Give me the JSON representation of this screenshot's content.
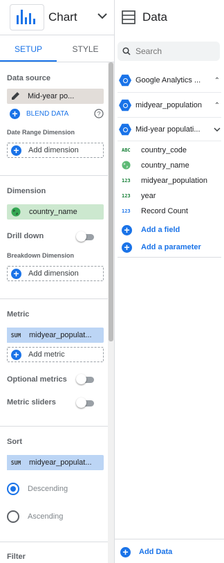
{
  "header": {
    "chart_label": "Chart",
    "data_label": "Data"
  },
  "tabs": [
    {
      "label": "SETUP",
      "active": true
    },
    {
      "label": "STYLE",
      "active": false
    }
  ],
  "setup": {
    "data_source": {
      "title": "Data source",
      "value": "Mid-year po...",
      "blend_label": "BLEND DATA"
    },
    "date_range": {
      "title": "Date Range Dimension",
      "add_label": "Add dimension"
    },
    "dimension": {
      "title": "Dimension",
      "value": "country_name"
    },
    "drill_down": {
      "label": "Drill down"
    },
    "breakdown": {
      "title": "Breakdown Dimension",
      "add_label": "Add dimension"
    },
    "metric": {
      "title": "Metric",
      "agg": "SUM",
      "value": "midyear_populat...",
      "add_label": "Add metric"
    },
    "optional_metrics": {
      "label": "Optional metrics"
    },
    "metric_sliders": {
      "label": "Metric sliders"
    },
    "sort": {
      "title": "Sort",
      "agg": "SUM",
      "value": "midyear_populat...",
      "descending": "Descending",
      "ascending": "Ascending"
    },
    "filter": {
      "title": "Filter"
    }
  },
  "data_panel": {
    "search_placeholder": "Search",
    "sources": [
      {
        "name": "Google Analytics ...",
        "expanded": false
      },
      {
        "name": "midyear_population",
        "expanded": false
      },
      {
        "name": "Mid-year populati...",
        "expanded": true
      }
    ],
    "fields": [
      {
        "type": "ABC",
        "name": "country_code"
      },
      {
        "type": "globe",
        "name": "country_name"
      },
      {
        "type": "123",
        "name": "midyear_population"
      },
      {
        "type": "123",
        "name": "year"
      },
      {
        "type": "123",
        "name": "Record Count"
      }
    ],
    "add_field": "Add a field",
    "add_parameter": "Add a parameter",
    "add_data": "Add Data"
  },
  "colors": {
    "accent": "#1a73e8",
    "dimension_chip": "#cce8cf",
    "metric_chip": "#bcd5f5",
    "datasource_chip": "#e2ddd9"
  }
}
